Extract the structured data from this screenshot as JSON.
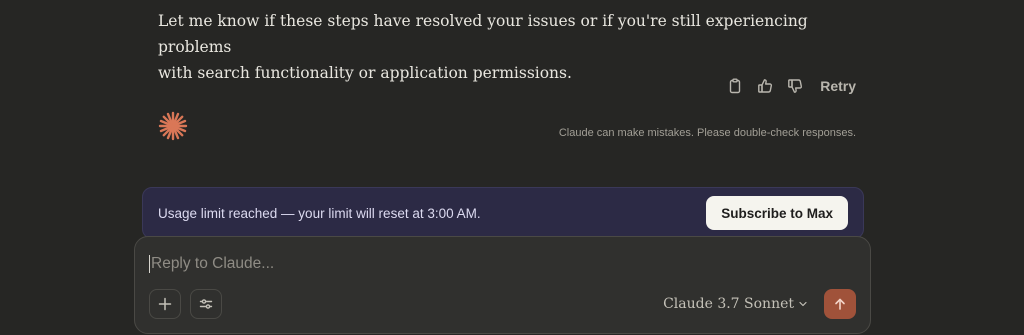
{
  "message": {
    "line1": "Let me know if these steps have resolved your issues or if you're still experiencing problems",
    "line2": "with search functionality or application permissions."
  },
  "actions": {
    "retry_label": "Retry"
  },
  "disclaimer": "Claude can make mistakes. Please double-check responses.",
  "usage_banner": {
    "text": "Usage limit reached — your limit will reset at 3:00 AM.",
    "button_label": "Subscribe to Max"
  },
  "composer": {
    "placeholder": "Reply to Claude...",
    "model": "Claude 3.7 Sonnet"
  },
  "colors": {
    "background": "#262624",
    "brand_accent": "#d97757",
    "send_button": "#a0523a",
    "banner_bg": "#2c2a45"
  },
  "icons": {
    "copy": "clipboard-icon",
    "thumbs_up": "thumbs-up-icon",
    "thumbs_down": "thumbs-down-icon",
    "logo": "claude-sparkle-icon",
    "add": "plus-icon",
    "options": "sliders-icon",
    "model_dropdown": "chevron-down-icon",
    "send": "arrow-up-icon"
  }
}
